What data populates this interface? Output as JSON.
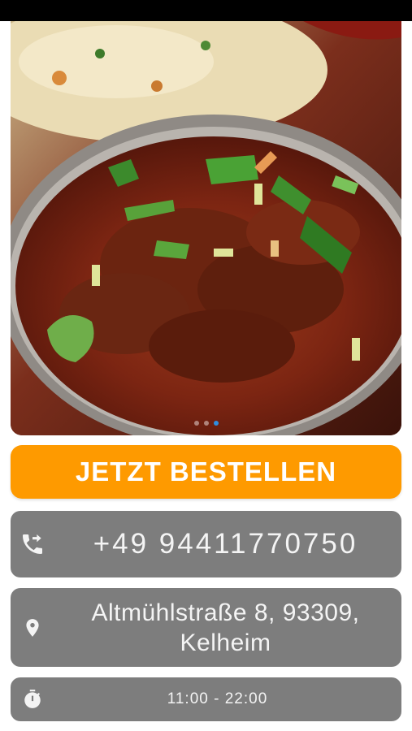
{
  "gallery": {
    "image_alt": "curry-dish-photo",
    "page_count": 3,
    "active_page": 3
  },
  "order_button": {
    "label": "JETZT BESTELLEN",
    "color": "#fe9a00"
  },
  "contact": {
    "phone": "+49 94411770750",
    "address_line1": "Altmühlstraße 8, 93309,",
    "address_line2": "Kelheim",
    "hours": "11:00 - 22:00",
    "card_color": "#7d7d7d"
  },
  "icons": {
    "phone": "phone-forward-icon",
    "location": "location-pin-icon",
    "hours": "stopwatch-icon"
  }
}
